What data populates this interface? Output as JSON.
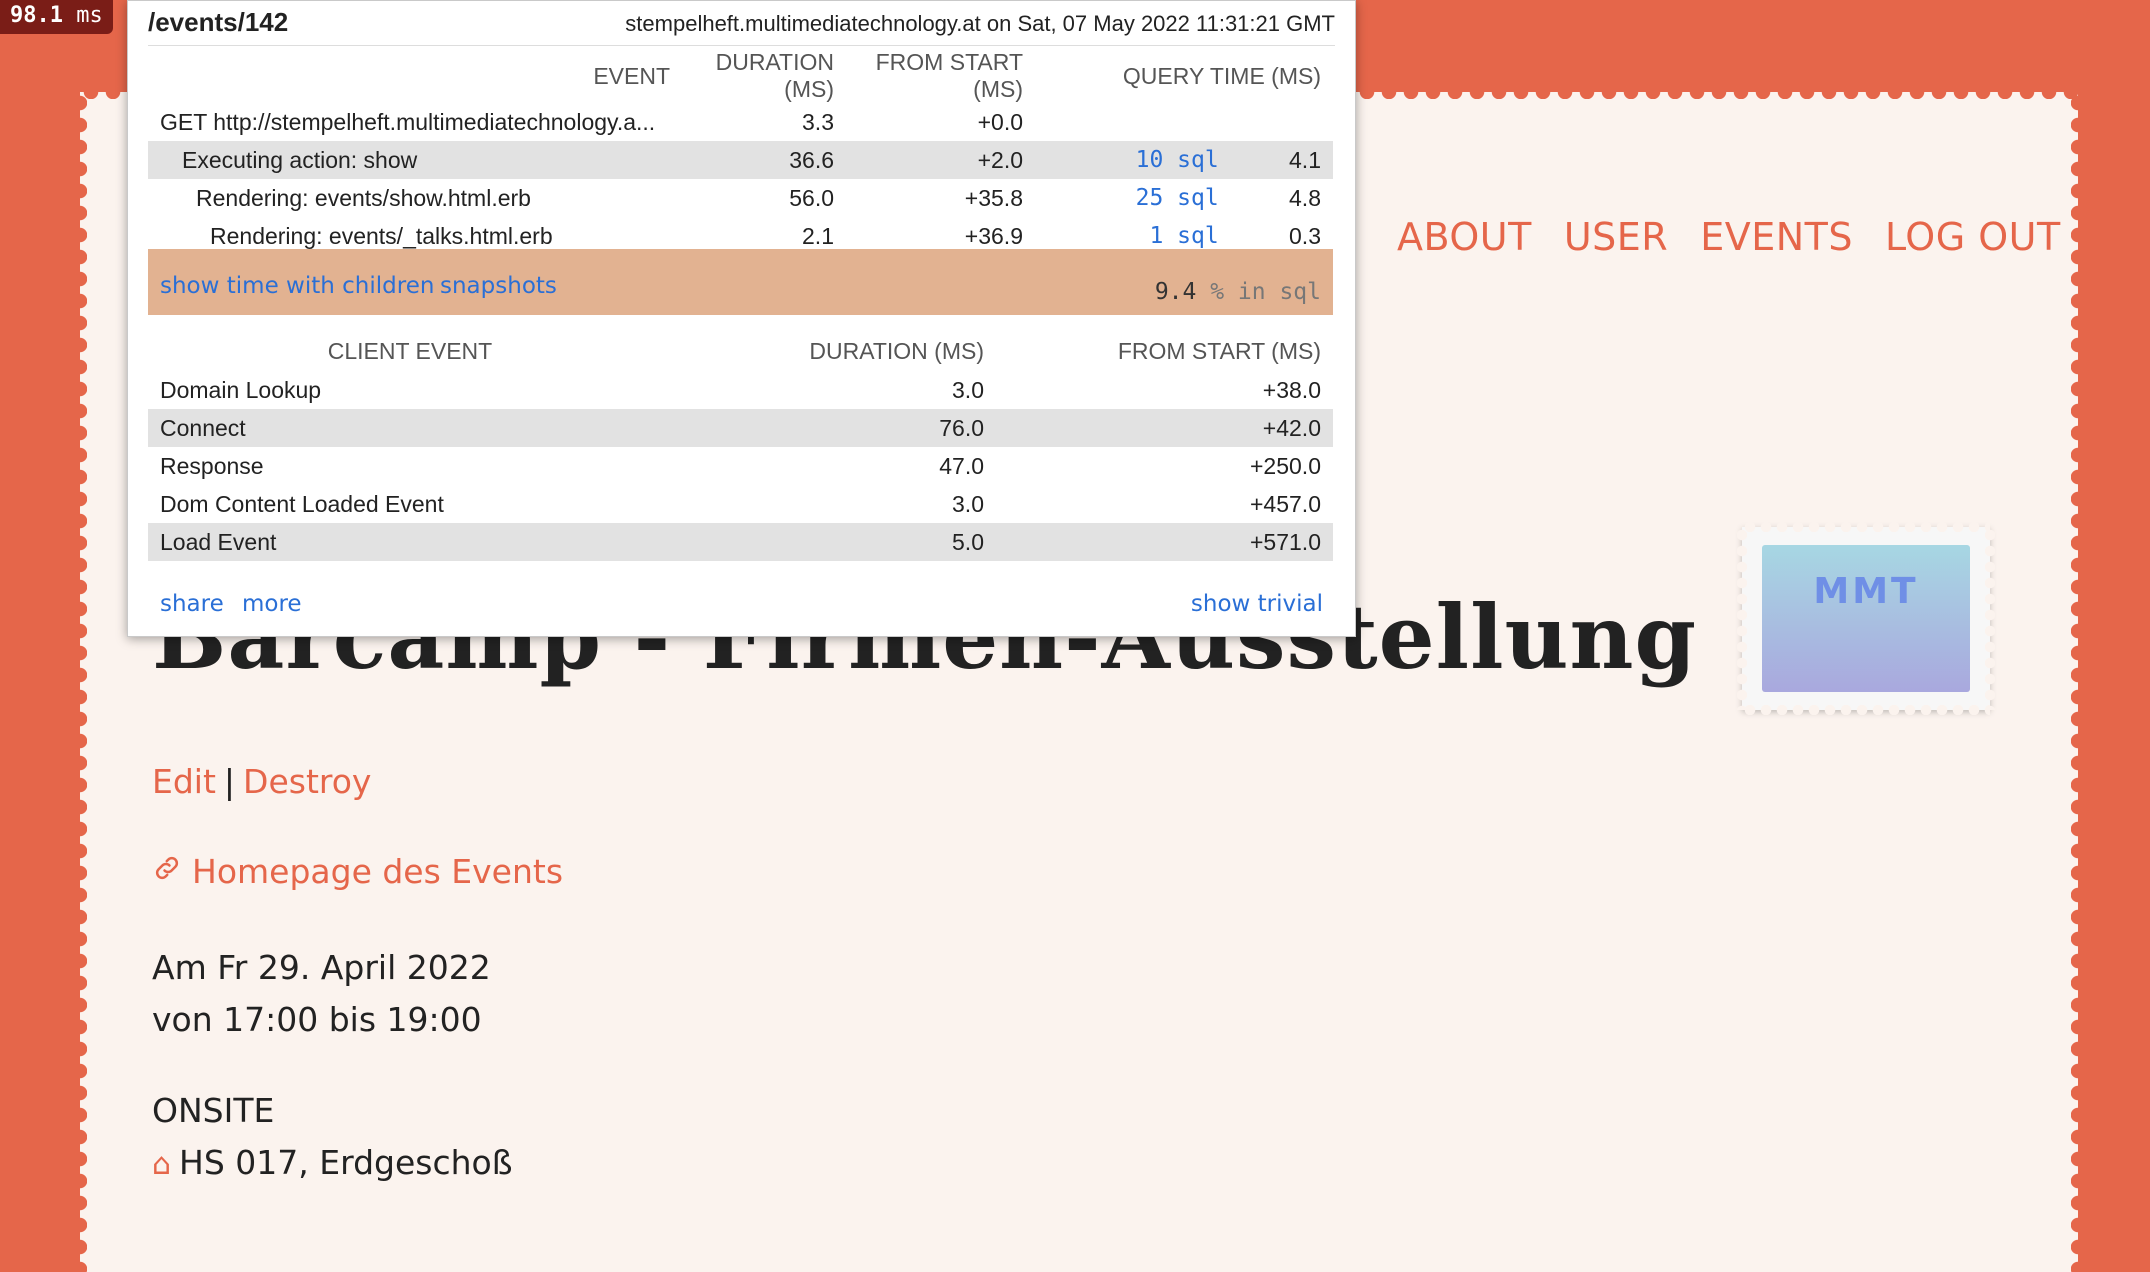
{
  "badge": {
    "value": "98.1",
    "unit": "ms"
  },
  "profiler": {
    "path": "/events/142",
    "host_info": "stempelheft.multimediatechnology.at on Sat, 07 May 2022 11:31:21 GMT",
    "server_headers": [
      "EVENT",
      "DURATION (MS)",
      "FROM START (MS)",
      "QUERY TIME (MS)"
    ],
    "server_rows": [
      {
        "event": "GET http://stempelheft.multimediatechnology.a...",
        "duration": "3.3",
        "from_start": "+0.0",
        "sql": "",
        "query_time": ""
      },
      {
        "event": "Executing action: show",
        "duration": "36.6",
        "from_start": "+2.0",
        "sql": "10 sql",
        "query_time": "4.1"
      },
      {
        "event": "Rendering: events/show.html.erb",
        "duration": "56.0",
        "from_start": "+35.8",
        "sql": "25 sql",
        "query_time": "4.8"
      },
      {
        "event": "Rendering: events/_talks.html.erb",
        "duration": "2.1",
        "from_start": "+36.9",
        "sql": "1 sql",
        "query_time": "0.3"
      }
    ],
    "summary": {
      "show_children": "show time with children",
      "snapshots": "snapshots",
      "sql_percent": "9.4",
      "sql_percent_label": "% in sql"
    },
    "client_headers": [
      "CLIENT EVENT",
      "DURATION (MS)",
      "FROM START (MS)"
    ],
    "client_rows": [
      {
        "event": "Domain Lookup",
        "duration": "3.0",
        "from_start": "+38.0"
      },
      {
        "event": "Connect",
        "duration": "76.0",
        "from_start": "+42.0"
      },
      {
        "event": "Response",
        "duration": "47.0",
        "from_start": "+250.0"
      },
      {
        "event": "Dom Content Loaded Event",
        "duration": "3.0",
        "from_start": "+457.0"
      },
      {
        "event": "Load Event",
        "duration": "5.0",
        "from_start": "+571.0"
      }
    ],
    "footer": {
      "share": "share",
      "more": "more",
      "show_trivial": "show trivial"
    }
  },
  "nav": {
    "about": "ABOUT",
    "user": "USER",
    "events": "EVENTS",
    "logout": "LOG OUT"
  },
  "logo": {
    "text": "MMT"
  },
  "event": {
    "title": "Barcamp - Firmen-Ausstellung",
    "edit": "Edit",
    "separator": "|",
    "destroy": "Destroy",
    "homepage": "Homepage des Events",
    "date_line": "Am Fr 29. April 2022",
    "time_line": "von 17:00 bis 19:00",
    "mode": "ONSITE",
    "room": "HS 017, Erdgeschoß"
  },
  "colors": {
    "accent": "#e5664a",
    "background": "#fbf3ee",
    "link": "#2a6fd6",
    "badge": "#7a1d17"
  }
}
